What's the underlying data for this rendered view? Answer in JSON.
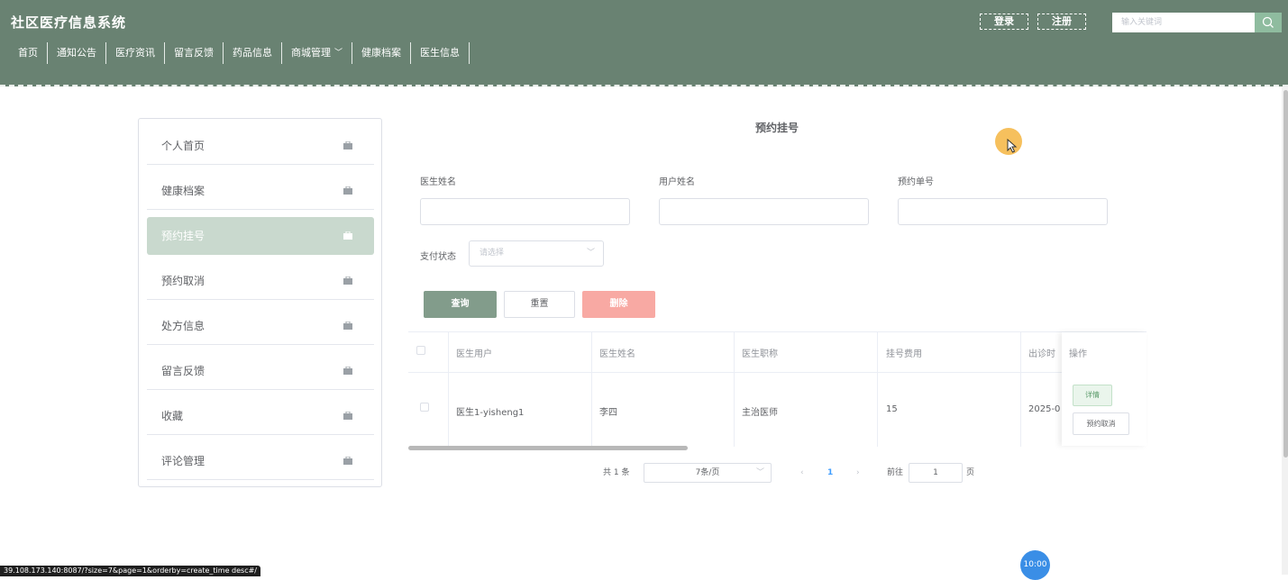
{
  "header": {
    "site_title": "社区医疗信息系统",
    "login": "登录",
    "register": "注册",
    "search_placeholder": "输入关键词",
    "nav": [
      "首页",
      "通知公告",
      "医疗资讯",
      "留言反馈",
      "药品信息",
      "商城管理",
      "健康档案",
      "医生信息"
    ]
  },
  "sidebar": {
    "items": [
      "个人首页",
      "健康档案",
      "预约挂号",
      "预约取消",
      "处方信息",
      "留言反馈",
      "收藏",
      "评论管理"
    ],
    "active_index": 2
  },
  "form": {
    "title": "预约挂号",
    "doctor_name_label": "医生姓名",
    "user_name_label": "用户姓名",
    "order_no_label": "预约单号",
    "pay_status_label": "支付状态",
    "pay_status_placeholder": "请选择",
    "query_button": "查询",
    "reset_button": "重置",
    "delete_button": "删除"
  },
  "table": {
    "columns": [
      "医生用户",
      "医生姓名",
      "医生职称",
      "挂号费用",
      "出诊时间",
      "操作"
    ],
    "columns_visible": [
      "医生用户",
      "医生姓名",
      "医生职称",
      "挂号费用",
      "出诊时",
      "操作"
    ],
    "rows": [
      {
        "doctor_user": "医生1-yisheng1",
        "doctor_name": "李四",
        "doctor_title": "主治医师",
        "fee": "15",
        "time": "2025-0"
      }
    ],
    "detail_button": "详情",
    "cancel_button": "预约取消"
  },
  "pagination": {
    "total": "共 1 条",
    "page_size": "7条/页",
    "current_page": "1",
    "goto_label": "前往",
    "goto_value": "1",
    "page_unit": "页"
  },
  "overlay": {
    "clock": "10:00",
    "status_url": "39.108.173.140:8087/?size=7&page=1&orderby=create_time desc#/"
  },
  "colors": {
    "header_bg": "#698272",
    "active_item": "#c9d9ce",
    "query_btn": "#829c8b",
    "delete_btn": "#f8a9a3"
  }
}
